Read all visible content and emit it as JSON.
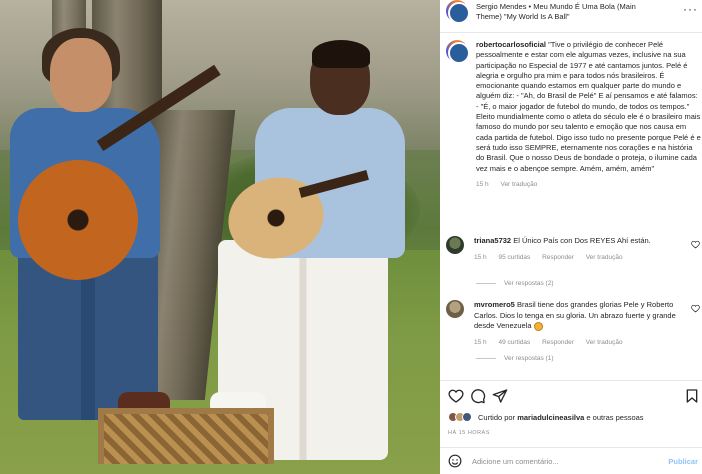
{
  "music": {
    "track": "Sergio Mendes • Meu Mundo É Uma Bola (Main Theme) \"My World Is A Ball\"",
    "more": "···"
  },
  "caption": {
    "username": "robertocarlosoficial",
    "text": "\"Tive o privilégio de conhecer Pelé pessoalmente e estar com ele algumas vezes, inclusive na sua participação no Especial de 1977 e até cantamos juntos. Pelé é alegria e orgulho pra mim e para todos nós brasileiros. É emocionante quando estamos em qualquer parte do mundo e alguém diz: - \"Ah, do Brasil de Pelé\" E aí pensamos e até falamos: - \"É, o maior jogador de futebol do mundo, de todos os tempos.\" Eleito mundialmente como o atleta do século ele é o brasileiro mais famoso do mundo por seu talento e emoção que nos causa em cada partida de futebol. Digo isso tudo no presente porque Pelé é e será tudo isso SEMPRE, eternamente nos corações e na história do Brasil. Que o nosso Deus de bondade o proteja, o ilumine cada vez mais e o abençoe sempre. Amém, amém, amém\"",
    "time": "15 h",
    "translation": "Ver tradução"
  },
  "comments": [
    {
      "username": "triana5732",
      "text": "El Único País con Dos REYES Ahí están.",
      "time": "15 h",
      "likes": "95 curtidas",
      "reply": "Responder",
      "translation": "Ver tradução",
      "replies": "Ver respostas (2)"
    },
    {
      "username": "mvromero5",
      "text": "Brasil tiene dos grandes glorias Pele y Roberto Carlos. Dios lo tenga en su gloria. Un abrazo fuerte y grande desde Venezuela",
      "time": "15 h",
      "likes": "49 curtidas",
      "reply": "Responder",
      "translation": "Ver tradução",
      "replies": "Ver respostas (1)"
    }
  ],
  "liked_by": {
    "prefix": "Curtido por",
    "user": "mariadulcineasilva",
    "suffix": "e outras pessoas"
  },
  "date": "HÁ 15 HORAS",
  "add_comment": {
    "placeholder": "Adicione um comentário...",
    "publish": "Publicar"
  },
  "icons": {
    "heart": "heart-icon",
    "comment": "comment-icon",
    "share": "share-icon",
    "save": "bookmark-icon",
    "emoji": "smiley-icon"
  },
  "colors": {
    "publish": "#8fc4f7",
    "muted": "#8e8e8e"
  }
}
